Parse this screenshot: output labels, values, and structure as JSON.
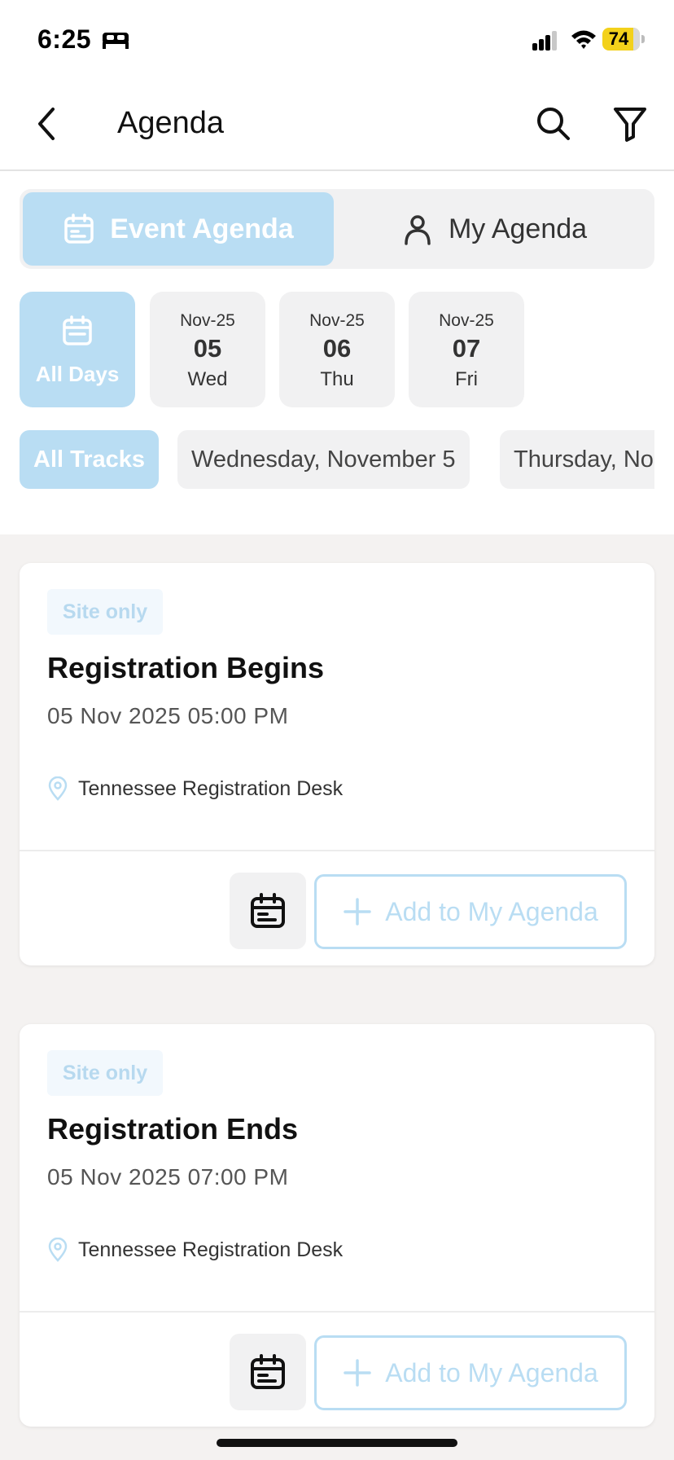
{
  "status_bar": {
    "time": "6:25",
    "battery": "74"
  },
  "header": {
    "title": "Agenda"
  },
  "tabs": {
    "event": "Event Agenda",
    "my": "My Agenda"
  },
  "days": {
    "all": "All Days",
    "items": [
      {
        "month": "Nov-25",
        "day": "05",
        "weekday": "Wed"
      },
      {
        "month": "Nov-25",
        "day": "06",
        "weekday": "Thu"
      },
      {
        "month": "Nov-25",
        "day": "07",
        "weekday": "Fri"
      }
    ]
  },
  "tracks": {
    "items": [
      "All Tracks",
      "Wednesday, November 5",
      "Thursday, No"
    ]
  },
  "sessions": [
    {
      "badge": "Site only",
      "title": "Registration Begins",
      "datetime": "05 Nov 2025 05:00 PM",
      "location": "Tennessee Registration Desk",
      "add_label": "Add to My Agenda"
    },
    {
      "badge": "Site only",
      "title": "Registration Ends",
      "datetime": "05 Nov 2025 07:00 PM",
      "location": "Tennessee Registration Desk",
      "add_label": "Add to My Agenda"
    }
  ],
  "colors": {
    "accent": "#b9ddf3",
    "chip_bg": "#f1f1f2",
    "list_bg": "#f4f2f1",
    "battery": "#f3d11b"
  }
}
